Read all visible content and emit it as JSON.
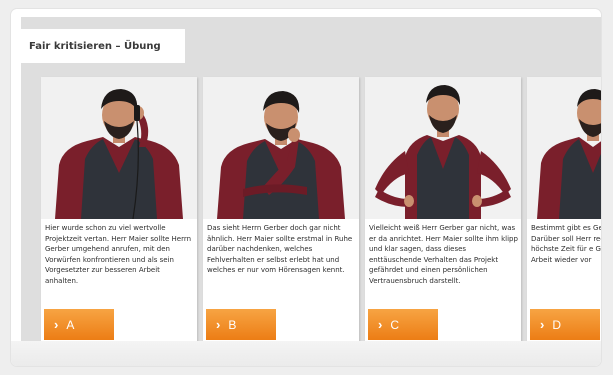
{
  "exercise": {
    "title": "Fair kritisieren – Übung"
  },
  "options": [
    {
      "text": "Hier wurde schon zu viel wertvolle Projektzeit vertan. Herr Maier sollte Herrn Gerber umgehend anrufen, mit den Vorwürfen konfrontieren und als sein Vorgesetzter zur besseren Arbeit anhalten.",
      "button_label": "A",
      "icon": "chevron-right-icon"
    },
    {
      "text": "Das sieht Herrn Gerber doch gar nicht ähnlich. Herr Maier sollte erstmal in Ruhe darüber nachdenken, welches Fehlverhalten er selbst erlebt hat und welches er nur vom Hörensagen kennt.",
      "button_label": "B",
      "icon": "chevron-right-icon"
    },
    {
      "text": "Vielleicht weiß Herr Gerber gar nicht, was er da anrichtet. Herr Maier sollte ihm klipp und klar sagen, dass dieses enttäuschende Verhalten das Projekt gefährdet und einen persönlichen Vertrauensbruch darstellt.",
      "button_label": "C",
      "icon": "chevron-right-icon"
    },
    {
      "text": "Bestimmt gibt es Gerbers veränder Darüber soll Herr reden, statt weite höchste Zeit für e Gespräch, damit d Arbeit wieder vor",
      "button_label": "D",
      "icon": "chevron-right-icon"
    }
  ],
  "colors": {
    "button_orange": "#ef8620",
    "shirt": "#7a1f2b",
    "vest": "#2f333a",
    "background": "#dedede"
  }
}
